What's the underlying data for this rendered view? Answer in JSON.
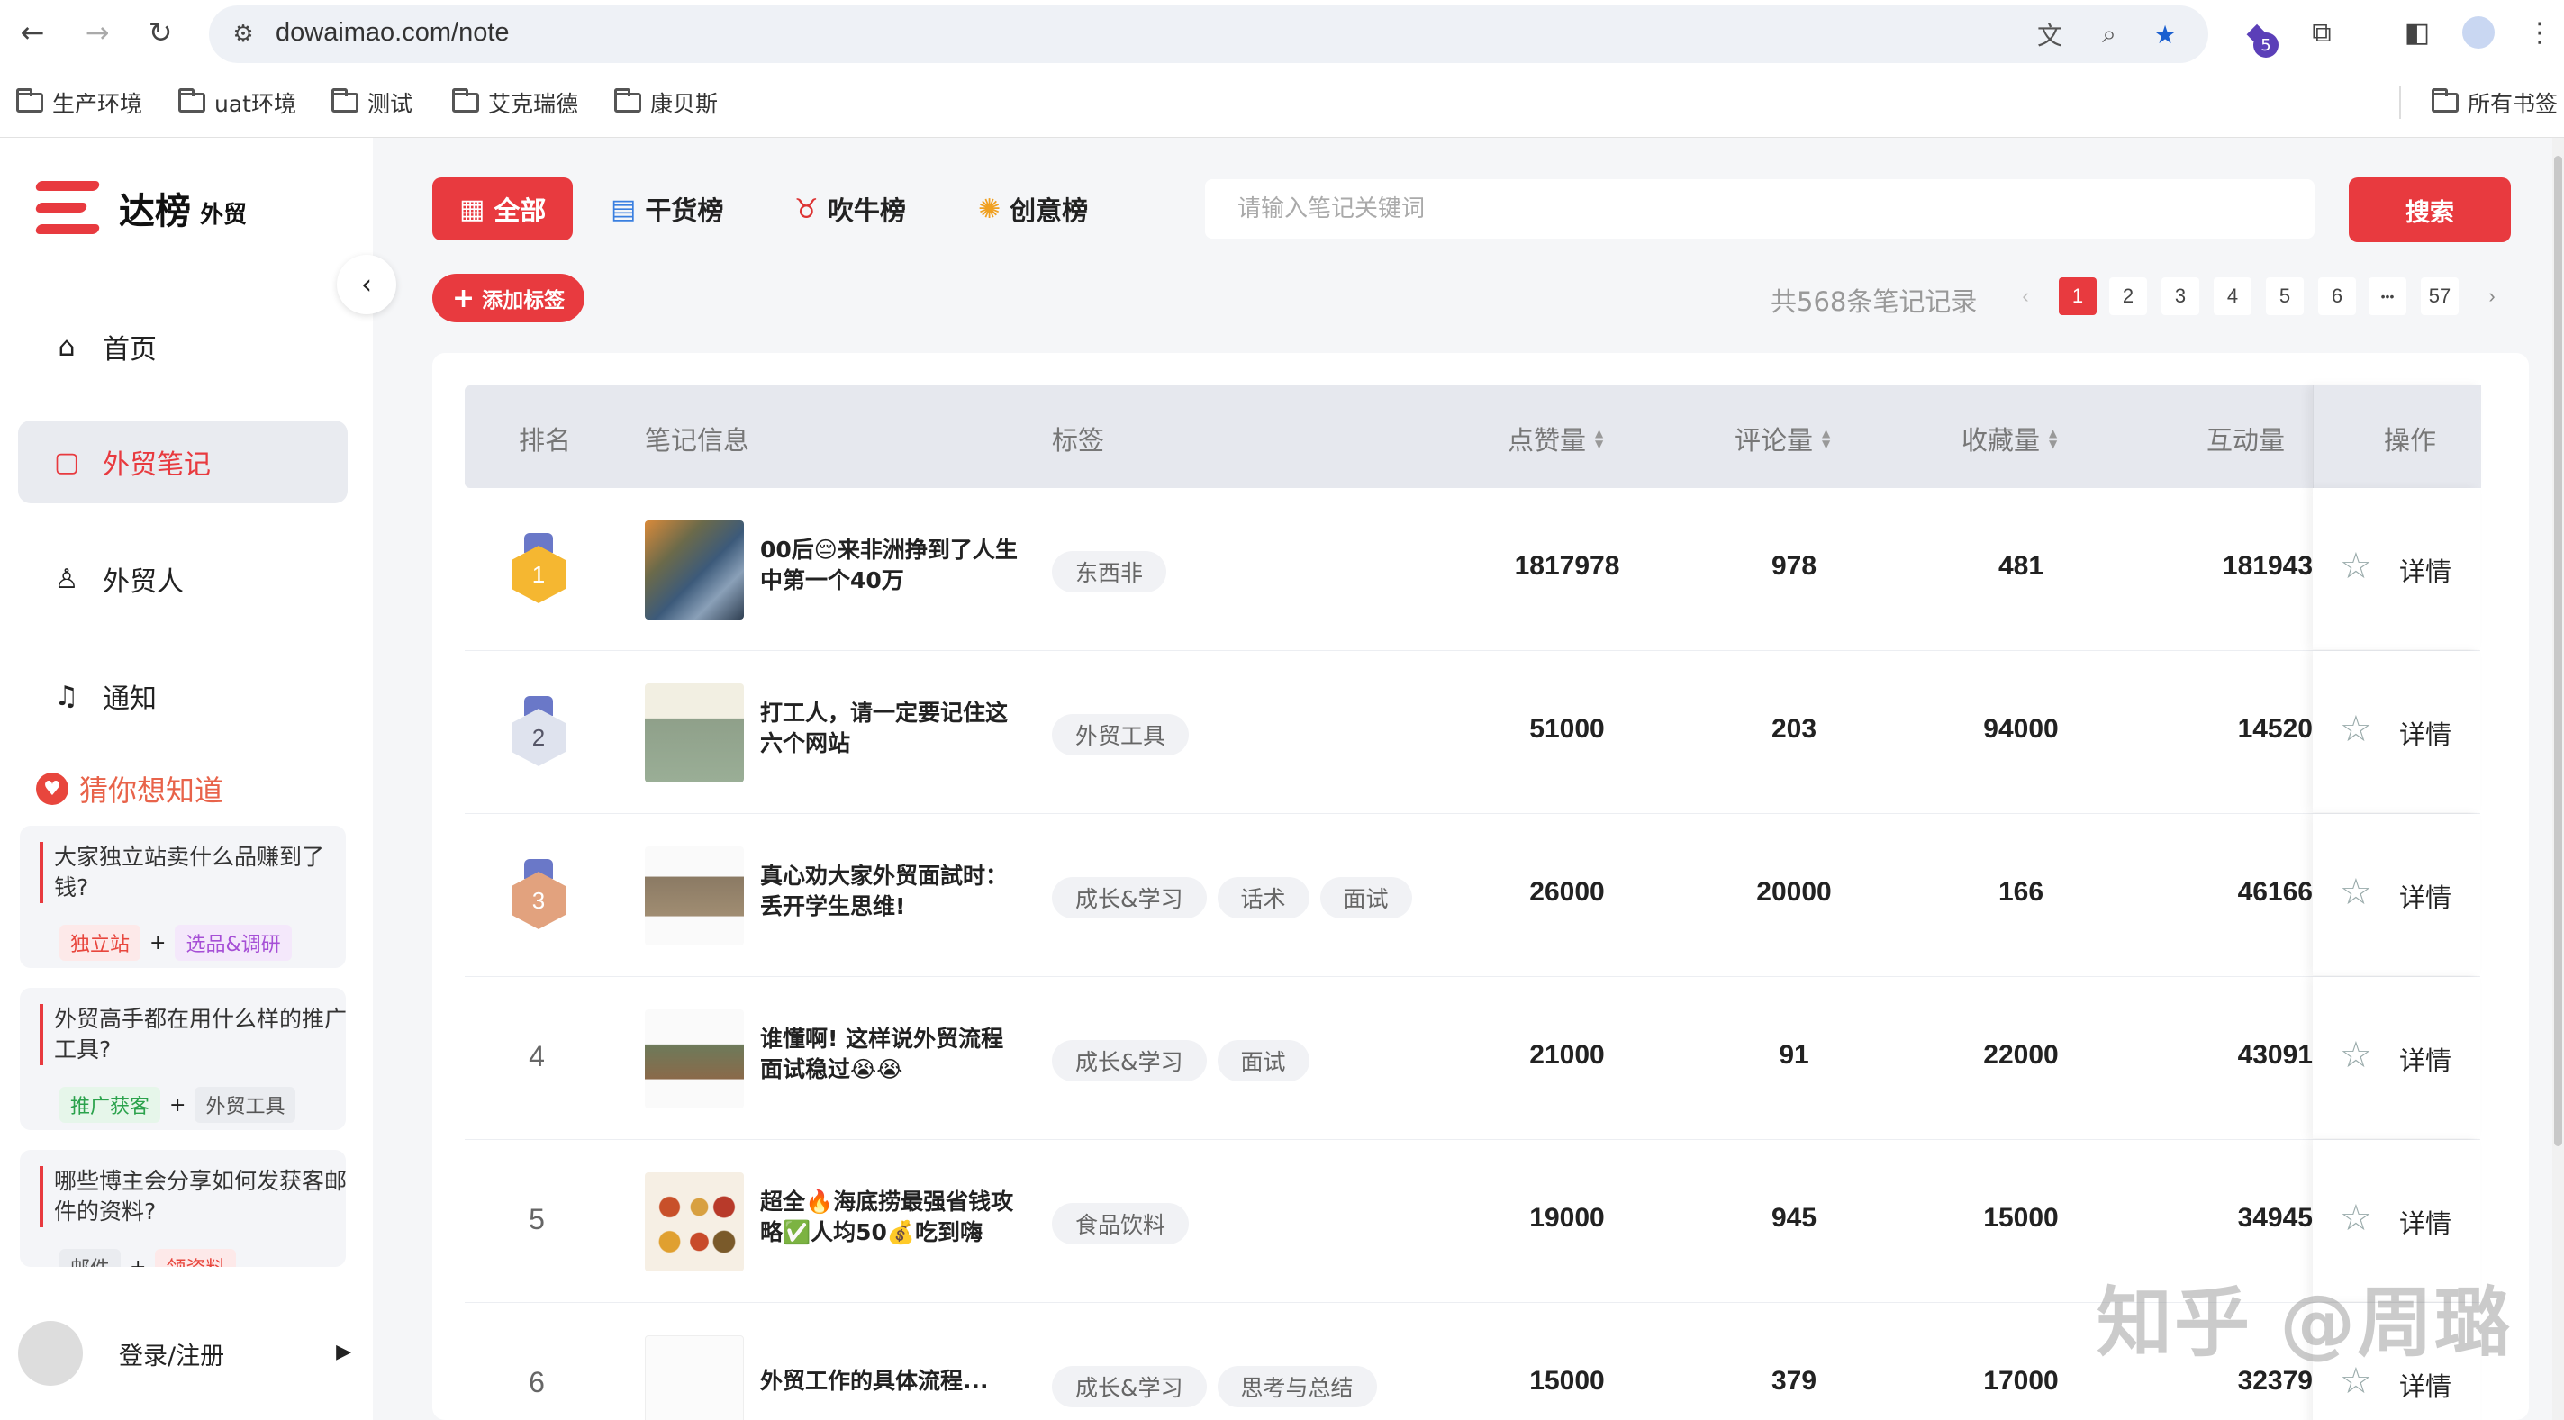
{
  "browser": {
    "url": "dowaimao.com/note",
    "bookmarks": [
      "生产环境",
      "uat环境",
      "测试",
      "艾克瑞德",
      "康贝斯"
    ],
    "all_bookmarks": "所有书签",
    "extension_badge": "5"
  },
  "sidebar": {
    "brand": "达榜",
    "brand_sub": "外贸",
    "menu": [
      {
        "label": "首页",
        "icon": "home-icon"
      },
      {
        "label": "外贸笔记",
        "icon": "note-icon",
        "active": true
      },
      {
        "label": "外贸人",
        "icon": "user-icon"
      },
      {
        "label": "通知",
        "icon": "bell-icon"
      }
    ],
    "guess_title": "猜你想知道",
    "questions": [
      {
        "text": "大家独立站卖什么品赚到了钱?",
        "tags": [
          "独立站",
          "选品&调研"
        ]
      },
      {
        "text": "外贸高手都在用什么样的推广工具?",
        "tags": [
          "推广获客",
          "外贸工具"
        ]
      },
      {
        "text": "哪些博主会分享如何发获客邮件的资料?",
        "tags": [
          "邮件",
          "领资料"
        ]
      }
    ],
    "login": "登录/注册"
  },
  "tabs": [
    {
      "label": "全部",
      "icon": "grid-icon"
    },
    {
      "label": "干货榜",
      "icon": "book-icon"
    },
    {
      "label": "吹牛榜",
      "icon": "bull-icon"
    },
    {
      "label": "创意榜",
      "icon": "bulb-icon"
    }
  ],
  "search": {
    "placeholder": "请输入笔记关键词",
    "button": "搜索"
  },
  "add_tag": "添加标签",
  "total": "共568条笔记记录",
  "pagination": {
    "pages": [
      "1",
      "2",
      "3",
      "4",
      "5",
      "6",
      "•••",
      "57"
    ],
    "current": "1"
  },
  "table": {
    "headers": {
      "rank": "排名",
      "info": "笔记信息",
      "tags": "标签",
      "likes": "点赞量",
      "comments": "评论量",
      "saves": "收藏量",
      "interactions": "互动量",
      "actions": "操作"
    },
    "detail_label": "详情",
    "rows": [
      {
        "rank": "1",
        "title": "00后😔来非洲挣到了人生中第一个40万",
        "tags": [
          "东西非"
        ],
        "likes": "1817978",
        "comments": "978",
        "saves": "481",
        "interactions": "181943"
      },
      {
        "rank": "2",
        "title": "打工人，请一定要记住这六个网站",
        "tags": [
          "外贸工具"
        ],
        "likes": "51000",
        "comments": "203",
        "saves": "94000",
        "interactions": "14520"
      },
      {
        "rank": "3",
        "title": "真心劝大家外贸面試时：丢开学生思维!",
        "tags": [
          "成长&学习",
          "话术",
          "面试"
        ],
        "likes": "26000",
        "comments": "20000",
        "saves": "166",
        "interactions": "46166"
      },
      {
        "rank": "4",
        "title": "谁懂啊! 这样说外贸流程面试稳过😭😭",
        "tags": [
          "成长&学习",
          "面试"
        ],
        "likes": "21000",
        "comments": "91",
        "saves": "22000",
        "interactions": "43091"
      },
      {
        "rank": "5",
        "title": "超全🔥海底捞最强省钱攻略✅人均50💰吃到嗨",
        "tags": [
          "食品饮料"
        ],
        "likes": "19000",
        "comments": "945",
        "saves": "15000",
        "interactions": "34945"
      },
      {
        "rank": "6",
        "title": "外贸工作的具体流程...",
        "tags": [
          "成长&学习",
          "思考与总结"
        ],
        "likes": "15000",
        "comments": "379",
        "saves": "17000",
        "interactions": "32379"
      }
    ]
  },
  "watermark": "知乎 @周璐",
  "colors": {
    "accent": "#e83a3f",
    "gold": "#f5b731",
    "silver": "#9aa6c6",
    "bronze": "#d8946c"
  }
}
